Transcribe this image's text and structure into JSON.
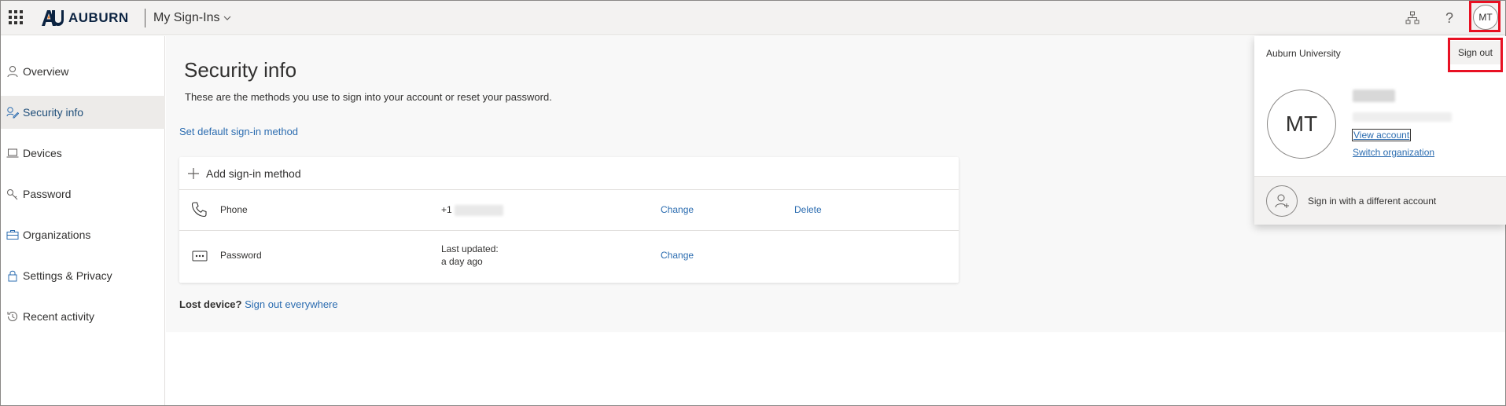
{
  "header": {
    "brand": "AUBURN",
    "app_title": "My Sign-Ins",
    "help_glyph": "?",
    "avatar_initials": "MT"
  },
  "sidebar": {
    "items": [
      {
        "label": "Overview",
        "icon": "person-icon",
        "active": false
      },
      {
        "label": "Security info",
        "icon": "security-info-icon",
        "active": true
      },
      {
        "label": "Devices",
        "icon": "laptop-icon",
        "active": false
      },
      {
        "label": "Password",
        "icon": "key-icon",
        "active": false
      },
      {
        "label": "Organizations",
        "icon": "briefcase-icon",
        "active": false
      },
      {
        "label": "Settings & Privacy",
        "icon": "lock-icon",
        "active": false
      },
      {
        "label": "Recent activity",
        "icon": "history-icon",
        "active": false
      }
    ]
  },
  "main": {
    "title": "Security info",
    "description": "These are the methods you use to sign into your account or reset your password.",
    "set_default_link": "Set default sign-in method",
    "add_method": "Add sign-in method",
    "methods": [
      {
        "name": "Phone",
        "icon": "phone-icon",
        "value": "+1",
        "change": "Change",
        "delete": "Delete"
      },
      {
        "name": "Password",
        "icon": "password-dots-icon",
        "updated_label": "Last updated:",
        "updated_value": "a day ago",
        "change": "Change"
      }
    ],
    "lost_device_label": "Lost device?",
    "sign_out_everywhere": "Sign out everywhere"
  },
  "account_flyout": {
    "organization": "Auburn University",
    "sign_out": "Sign out",
    "initials": "MT",
    "view_account": "View account",
    "switch_organization": "Switch organization",
    "different_account": "Sign in with a different account"
  },
  "colors": {
    "link": "#2b6cb0",
    "highlight_box": "#e81123",
    "header_bg": "#f3f2f1",
    "main_bg": "#f8f8f8",
    "brand_navy": "#0b2341",
    "brand_orange": "#e87722"
  }
}
